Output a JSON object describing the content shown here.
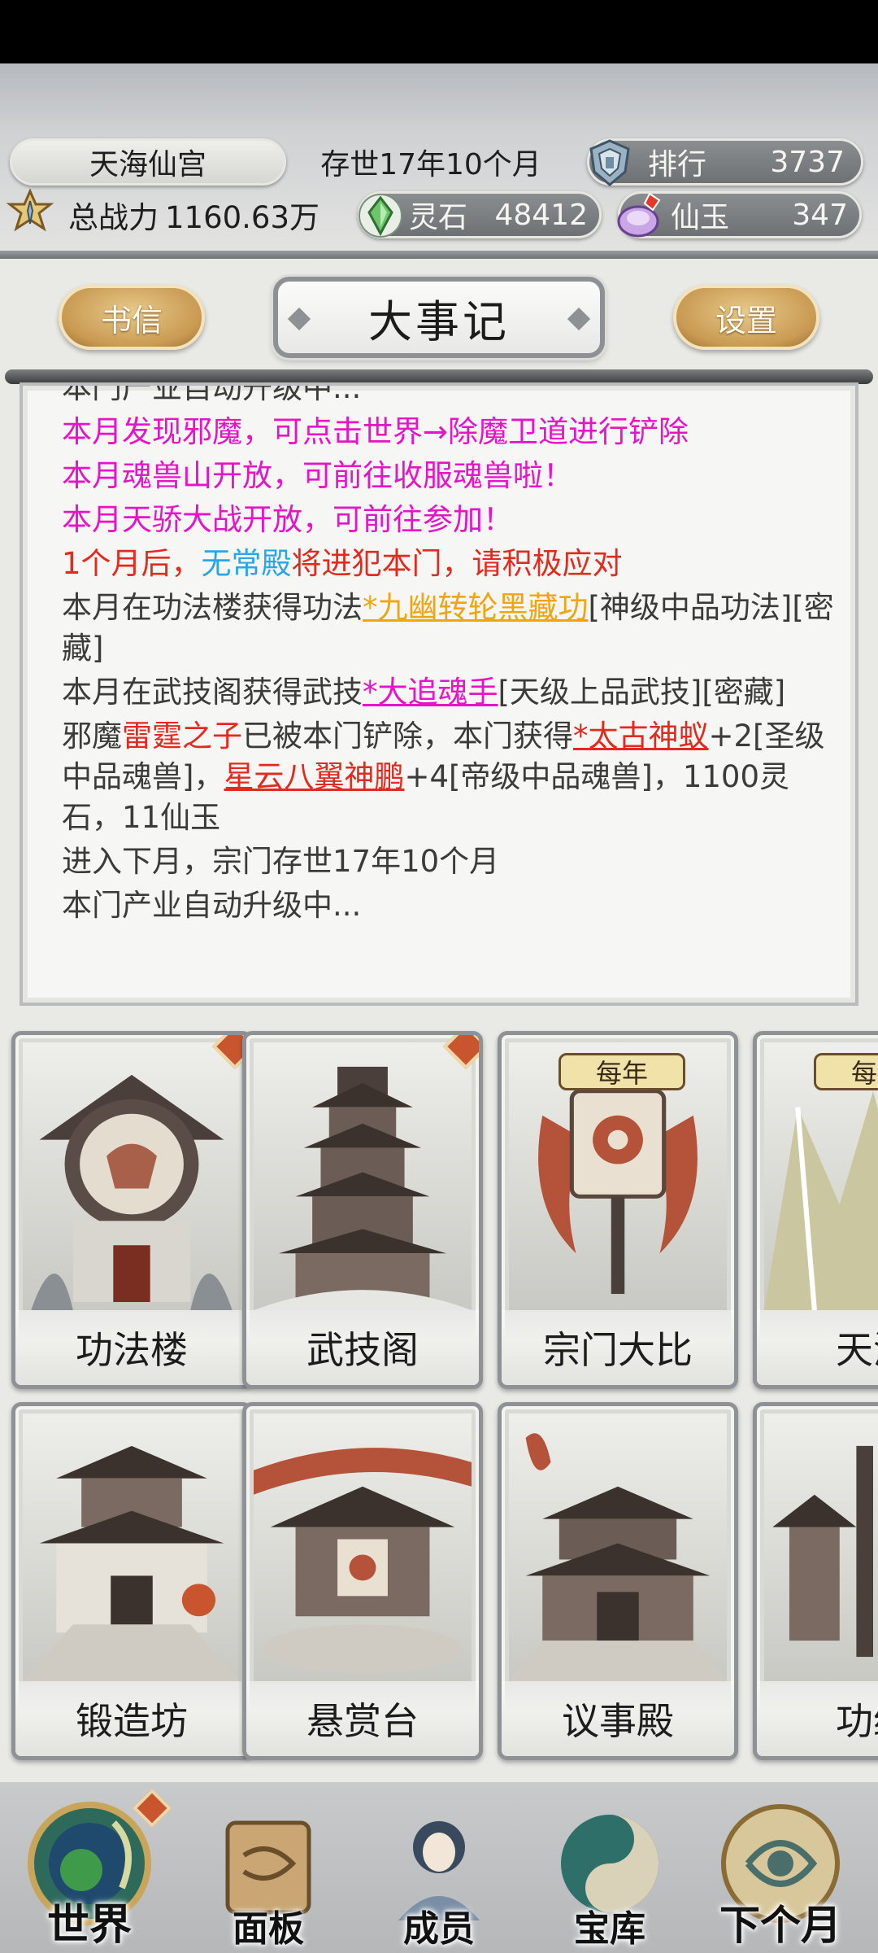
{
  "header": {
    "sect_name": "天海仙宫",
    "sect_age": "存世17年10个月",
    "rank_label": "排行",
    "rank_value": "3737",
    "power_label": "总战力",
    "power_value": "1160.63万",
    "stone_label": "灵石",
    "stone_value": "48412",
    "jade_label": "仙玉",
    "jade_value": "347"
  },
  "toolbar": {
    "letters_label": "书信",
    "title": "大事记",
    "settings_label": "设置"
  },
  "log": {
    "line0": "本门产业自动升级中...",
    "line1": "本月发现邪魔，可点击世界→除魔卫道进行铲除",
    "line2": "本月魂兽山开放，可前往收服魂兽啦！",
    "line3": "本月天骄大战开放，可前往参加！",
    "line4_a": "1个月后，",
    "line4_b": "无常殿",
    "line4_c": "将进犯本门，请积极应对",
    "line5_a": "本月在功法楼获得功法",
    "line5_b": "*九幽转轮黑藏功",
    "line5_c": "[神级中品功法][密藏]",
    "line6_a": "本月在武技阁获得武技",
    "line6_b": "*大追魂手",
    "line6_c": "[天级上品武技][密藏]",
    "line7_a": "邪魔",
    "line7_b": "雷霆之子",
    "line7_c": "已被本门铲除，本门获得",
    "line7_d": "*太古神蚁",
    "line7_e": "+2[圣级中品魂兽]，",
    "line7_f": "星云八翼神鹏",
    "line7_g": "+4[帝级中品魂兽]，1100灵石，11仙玉",
    "line8": "进入下月，宗门存世17年10个月",
    "line9": "本门产业自动升级中..."
  },
  "buildings": [
    {
      "label": "功法楼"
    },
    {
      "label": "武技阁"
    },
    {
      "label": "宗门大比",
      "tag": "每年"
    },
    {
      "label": "天涯",
      "tag": "每年"
    },
    {
      "label": "锻造坊"
    },
    {
      "label": "悬赏台"
    },
    {
      "label": "议事殿"
    },
    {
      "label": "功绩"
    }
  ],
  "nav": {
    "world": "世界",
    "panel": "面板",
    "members": "成员",
    "vault": "宝库",
    "next_month": "下个月"
  },
  "colors": {
    "event_magenta": "#e613c8",
    "warning_red": "#e22b1f",
    "faction_blue": "#2aa6e6",
    "gold_link": "#f0a512",
    "gold_button": "#c99a52"
  }
}
